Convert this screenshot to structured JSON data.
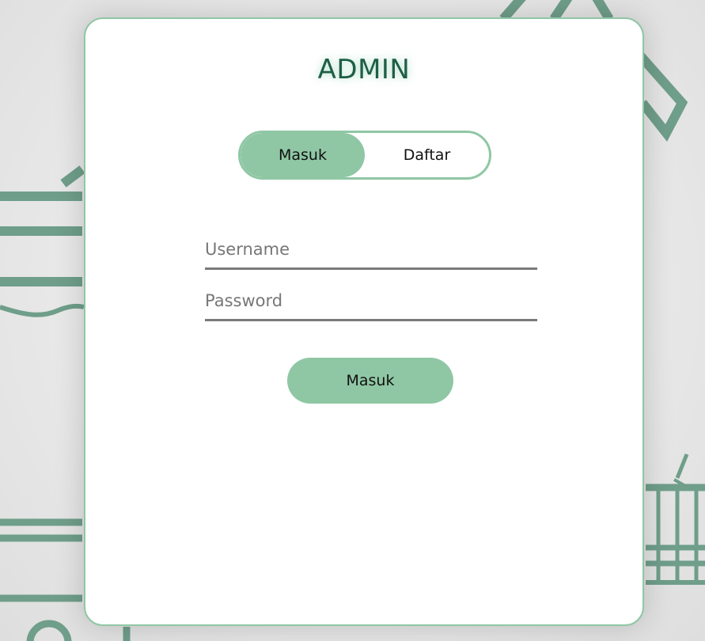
{
  "title": "ADMIN",
  "toggle": {
    "login_label": "Masuk",
    "register_label": "Daftar",
    "active": "Masuk"
  },
  "form": {
    "username_placeholder": "Username",
    "password_placeholder": "Password",
    "submit_label": "Masuk"
  },
  "colors": {
    "accent": "#8fc7a4",
    "title": "#1f5e45",
    "art": "#6f9e8a"
  }
}
